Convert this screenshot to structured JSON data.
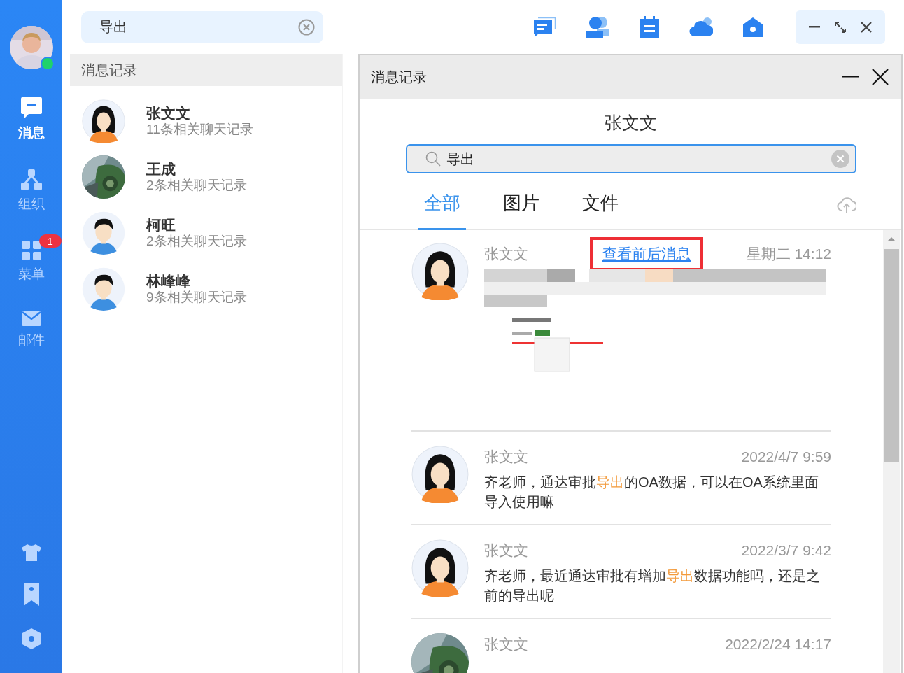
{
  "sidebar": {
    "user": {
      "online": true
    },
    "items": [
      {
        "label": "消息",
        "kind": "chat",
        "selected": true
      },
      {
        "label": "组织",
        "kind": "org",
        "selected": false
      },
      {
        "label": "菜单",
        "kind": "apps",
        "selected": false,
        "badge": "1"
      },
      {
        "label": "邮件",
        "kind": "mail",
        "selected": false
      }
    ]
  },
  "search": {
    "value": "导出"
  },
  "results": {
    "title": "消息记录",
    "contacts": [
      {
        "name": "张文文",
        "summary": "11条相关聊天记录",
        "avatar": {
          "kind": "girl"
        }
      },
      {
        "name": "王成",
        "summary": "2条相关聊天记录"
      },
      {
        "name": "柯旺",
        "summary": "2条相关聊天记录",
        "avatar": {
          "kind": "boy"
        }
      },
      {
        "name": "林峰峰",
        "summary": "9条相关聊天记录",
        "avatar": {
          "kind": "boy"
        }
      }
    ]
  },
  "dialog": {
    "title": "消息记录",
    "contact": "张文文",
    "search": {
      "value": "导出"
    },
    "tabs": [
      {
        "label": "全部",
        "selected": true
      },
      {
        "label": "图片",
        "selected": false
      },
      {
        "label": "文件",
        "selected": false
      }
    ],
    "messages": [
      {
        "sender": "张文文",
        "time": "星期二 14:12",
        "avatar": {
          "kind": "girl"
        },
        "link": {
          "label": "查看前后消息",
          "outlined": true
        }
      },
      {
        "sender": "张文文",
        "time": "2022/4/7 9:59",
        "avatar": {
          "kind": "girl"
        },
        "kind": "text",
        "parts": [
          {
            "text": "齐老师，通达审批",
            "highlight": false
          },
          {
            "text": "导出",
            "highlight": true
          },
          {
            "text": "的OA数据，可以在OA系统里面导入使用嘛",
            "highlight": false
          }
        ]
      },
      {
        "sender": "张文文",
        "time": "2022/3/7 9:42",
        "avatar": {
          "kind": "girl"
        },
        "kind": "text",
        "parts": [
          {
            "text": "齐老师，最近通达审批有增加",
            "highlight": false
          },
          {
            "text": "导出",
            "highlight": true
          },
          {
            "text": "数据功能吗，还是之前的导出呢",
            "highlight": false
          }
        ]
      },
      {
        "sender": "张文文",
        "time": "2022/2/24 14:17",
        "kind": "text"
      }
    ]
  }
}
